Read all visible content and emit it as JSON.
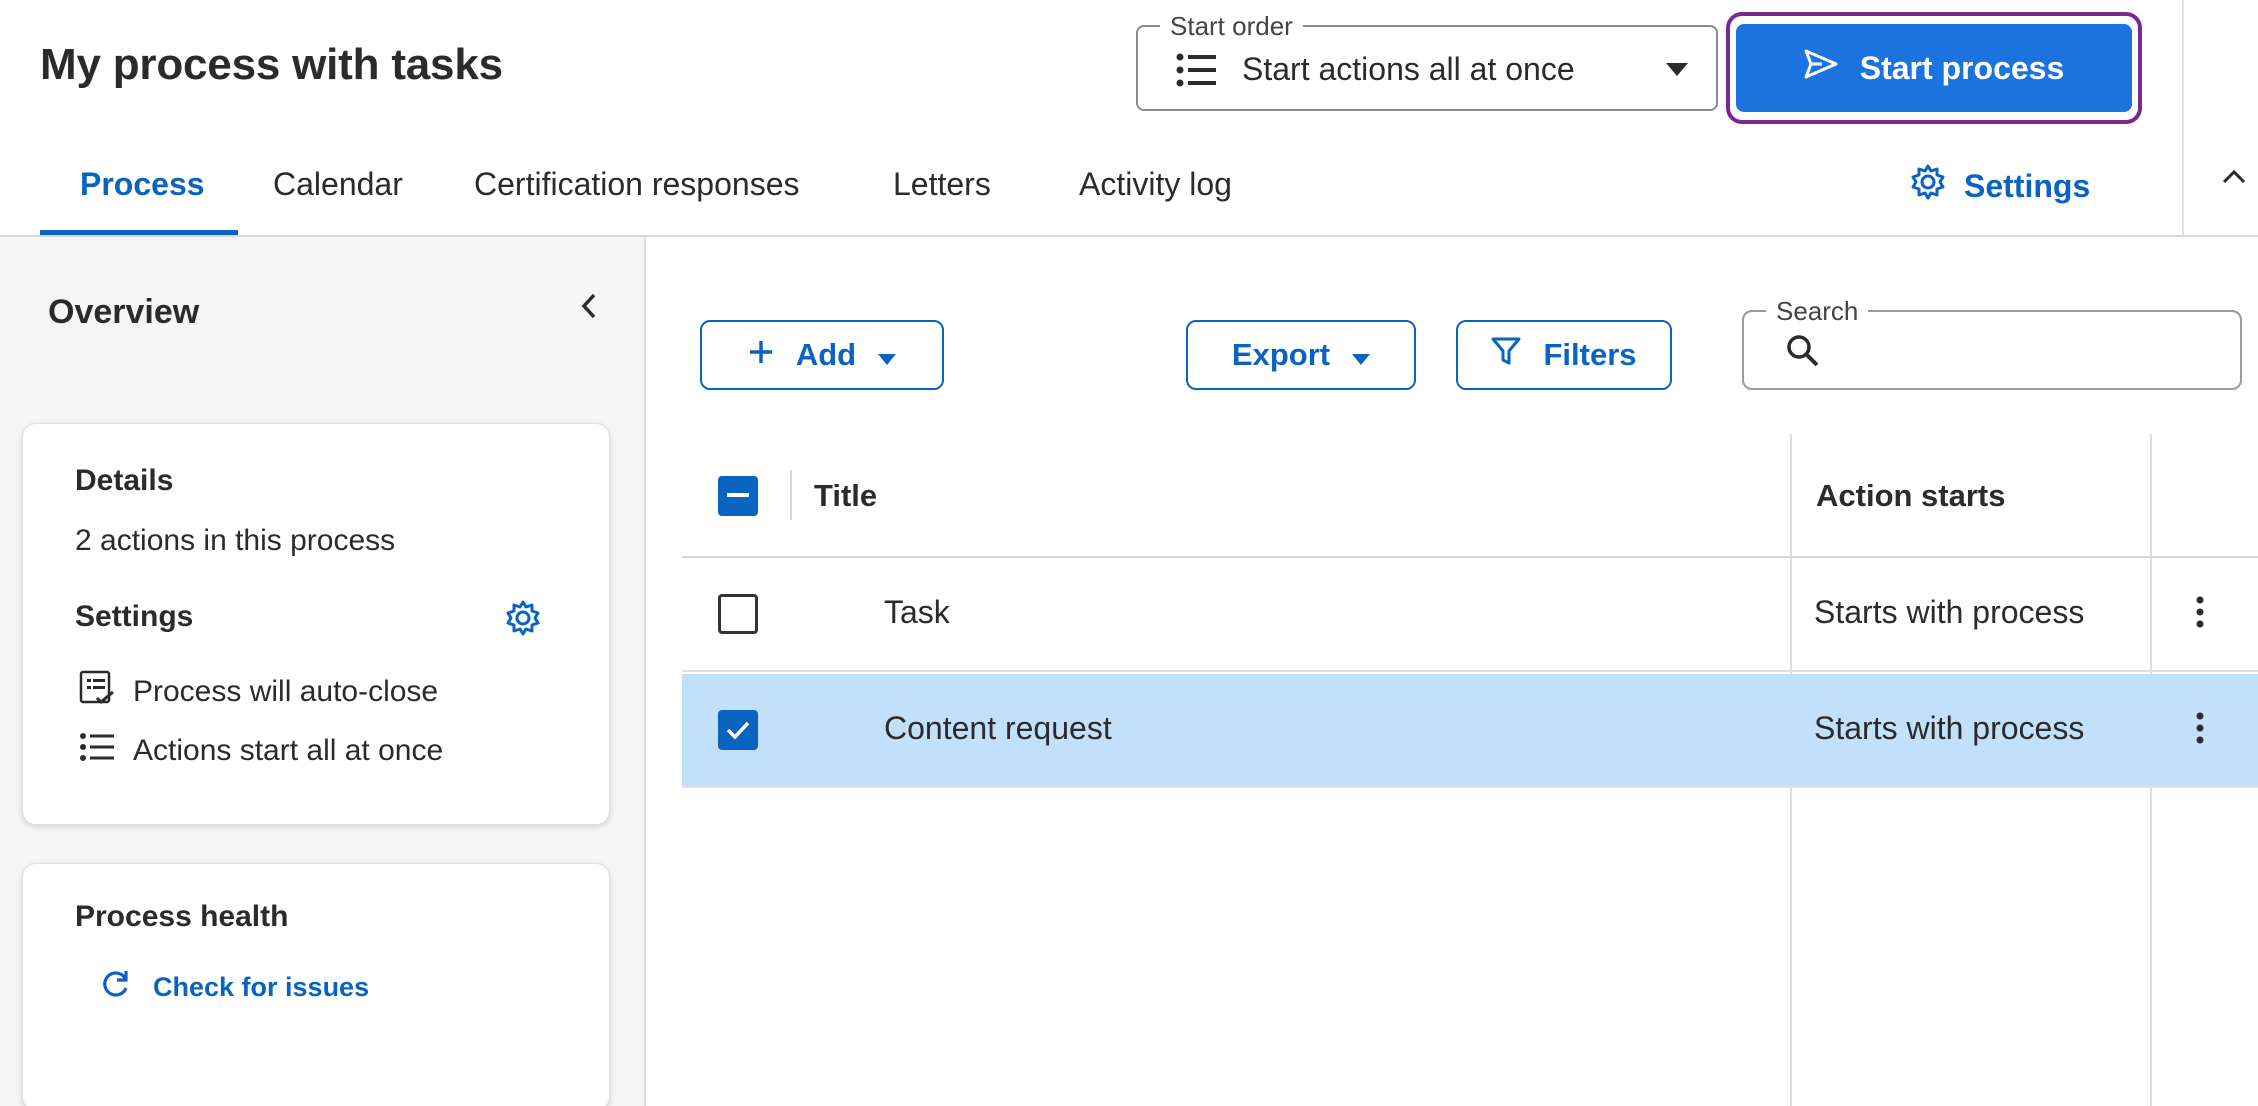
{
  "header": {
    "title": "My process with tasks",
    "start_order": {
      "label": "Start order",
      "value": "Start actions all at once"
    },
    "start_button_label": "Start process",
    "settings_label": "Settings"
  },
  "tabs": [
    {
      "label": "Process",
      "active": true
    },
    {
      "label": "Calendar",
      "active": false
    },
    {
      "label": "Certification responses",
      "active": false
    },
    {
      "label": "Letters",
      "active": false
    },
    {
      "label": "Activity log",
      "active": false
    }
  ],
  "sidebar": {
    "title": "Overview",
    "details": {
      "heading": "Details",
      "summary": "2 actions in this process",
      "settings_heading": "Settings",
      "items": [
        {
          "icon": "auto-close-icon",
          "label": "Process will auto-close"
        },
        {
          "icon": "list-icon",
          "label": "Actions start all at once"
        }
      ]
    },
    "health": {
      "heading": "Process health",
      "link": "Check for issues"
    }
  },
  "toolbar": {
    "add_label": "Add",
    "export_label": "Export",
    "filters_label": "Filters",
    "search_label": "Search",
    "search_value": ""
  },
  "table": {
    "columns": [
      "Title",
      "Action starts"
    ],
    "header_checkbox": "indeterminate",
    "rows": [
      {
        "title": "Task",
        "action_starts": "Starts with process",
        "checked": false
      },
      {
        "title": "Content request",
        "action_starts": "Starts with process",
        "checked": true
      }
    ]
  },
  "colors": {
    "primary": "#0b63c1",
    "primary_button": "#1a73de",
    "focus_ring": "#7a2a8e",
    "selected_row": "#c3e0fb",
    "sidebar_bg": "#f5f5f5"
  }
}
